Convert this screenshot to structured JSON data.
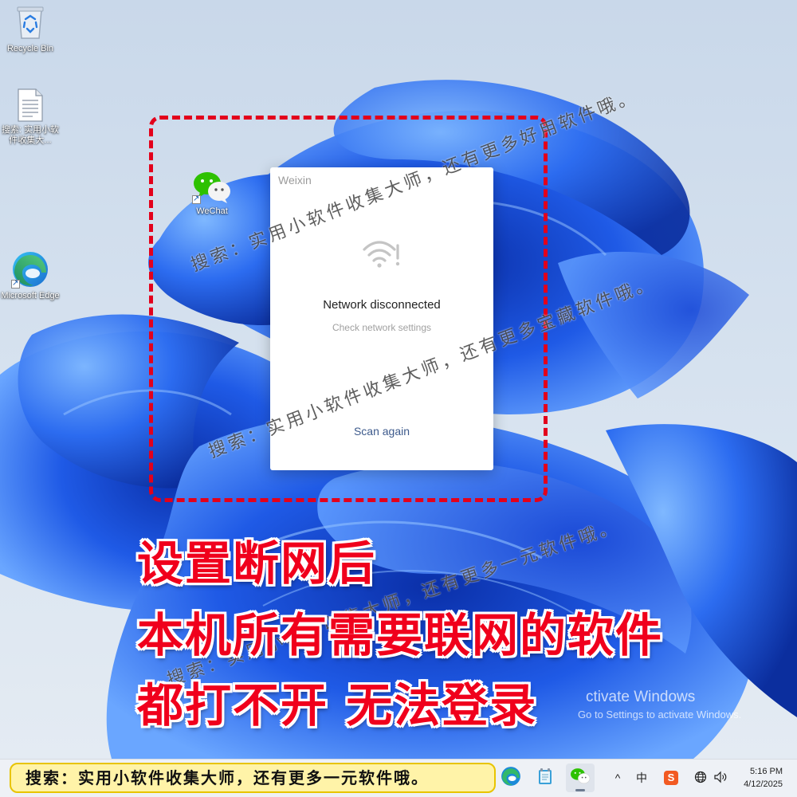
{
  "desktop": {
    "icons": [
      {
        "label": "Recycle Bin",
        "icon": "recycle-bin-icon"
      },
      {
        "label": "搜索: 实用小软件收集大...",
        "icon": "text-file-icon"
      },
      {
        "label": "WeChat",
        "icon": "wechat-icon"
      },
      {
        "label": "Microsoft Edge",
        "icon": "edge-icon"
      }
    ]
  },
  "dialog": {
    "title": "Weixin",
    "icon": "wifi-disconnected-icon",
    "heading": "Network disconnected",
    "subtext": "Check network settings",
    "action": "Scan again"
  },
  "watermarks": [
    "搜索：实用小软件收集大师，还有更多好用软件哦。",
    "搜索：实用小软件收集大师，还有更多宝藏软件哦。",
    "搜索：实用小软件收集大师，还有更多一元软件哦。"
  ],
  "caption": {
    "line1": "设置断网后",
    "line2": "本机所有需要联网的软件",
    "line3": "都打不开 无法登录"
  },
  "activation": {
    "line1": "ctivate Windows",
    "line2": "Go to Settings to activate Windows."
  },
  "taskbar": {
    "banner": "搜索：实用小软件收集大师，还有更多一元软件哦。",
    "apps": [
      "edge-icon",
      "notepad-icon",
      "wechat-icon"
    ],
    "tray": {
      "chevron": "^",
      "ime": "中",
      "sogou": "S",
      "network_icon": "globe-icon",
      "volume_icon": "speaker-icon"
    },
    "time": "5:16 PM",
    "date": "4/12/2025"
  },
  "colors": {
    "accent_red": "#f0001c",
    "banner_yellow": "#fff3a8",
    "wallpaper_blue": "#1e4fd8"
  }
}
